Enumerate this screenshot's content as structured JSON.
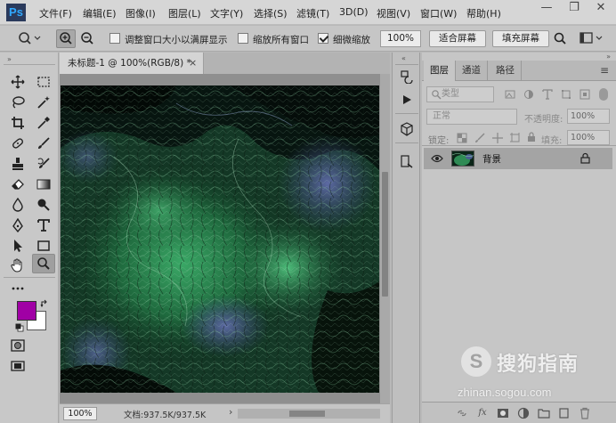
{
  "app": {
    "logo": "Ps"
  },
  "menubar": {
    "items": [
      "文件(F)",
      "编辑(E)",
      "图像(I)",
      "图层(L)",
      "文字(Y)",
      "选择(S)",
      "滤镜(T)",
      "3D(D)",
      "视图(V)",
      "窗口(W)",
      "帮助(H)"
    ]
  },
  "window_controls": {
    "minimize": "—",
    "restore": "❐",
    "close": "✕"
  },
  "options_bar": {
    "resize_windows_label": "调整窗口大小以满屏显示",
    "resize_windows_checked": false,
    "zoom_all_label": "缩放所有窗口",
    "zoom_all_checked": false,
    "scrubby_zoom_label": "细微缩放",
    "scrubby_zoom_checked": true,
    "zoom_value": "100%",
    "fit_screen_label": "适合屏幕",
    "fill_screen_label": "填充屏幕"
  },
  "document": {
    "tab_title": "未标题-1 @ 100%(RGB/8) *",
    "tab_close": "×",
    "status_zoom": "100%",
    "status_info": "文档:937.5K/937.5K",
    "status_arrow": "›"
  },
  "layers_panel": {
    "tabs": [
      "图层",
      "通道",
      "路径"
    ],
    "active_tab": 0,
    "filter_type_label": "类型",
    "blend_mode": "正常",
    "opacity_label": "不透明度:",
    "opacity_value": "100%",
    "lock_label": "锁定:",
    "fill_label": "填充:",
    "fill_value": "100%",
    "layers": [
      {
        "name": "背景",
        "visible": true,
        "locked": true
      }
    ]
  },
  "colors": {
    "foreground": "#a000a5",
    "background": "#ffffff",
    "accent": "#30a8ff"
  },
  "watermark": {
    "logo_letter": "S",
    "brand": "搜狗指南",
    "url": "zhinan.sogou.com"
  }
}
